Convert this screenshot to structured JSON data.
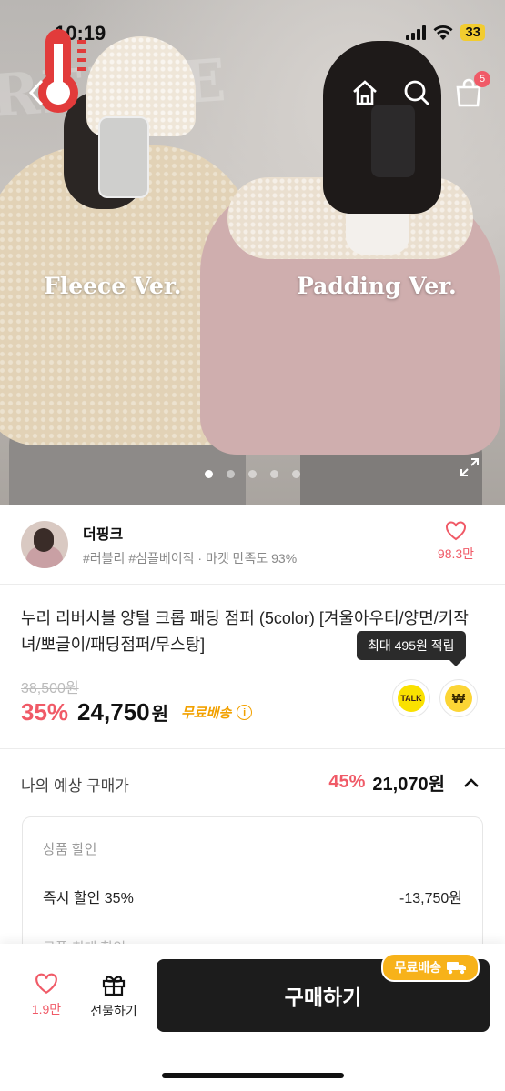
{
  "status": {
    "time": "10:19",
    "battery": "33"
  },
  "hero": {
    "bg_text": "RERSE",
    "label_left": "Fleece Ver.",
    "label_right": "Padding Ver.",
    "cart_count": "5",
    "slide_count": 5,
    "active_slide": 1
  },
  "shop": {
    "name": "더핑크",
    "tags": "#러블리 #심플베이직 · 마켓 만족도 93%",
    "likes": "98.3만"
  },
  "product": {
    "title": "누리 리버시블 양털 크롭 패딩 점퍼 (5color) [겨울아우터/양면/키작녀/뽀글이/패딩점퍼/무스탕]",
    "tooltip": "최대 495원 적립",
    "original_price": "38,500원",
    "discount": "35%",
    "price": "24,750",
    "price_unit": "원",
    "free_shipping": "무료배송",
    "talk_label": "TALK",
    "won_symbol": "₩"
  },
  "estimate": {
    "label": "나의 예상 구매가",
    "discount": "45%",
    "price": "21,070원"
  },
  "breakdown": {
    "title": "상품 할인",
    "row_label": "즉시 할인 35%",
    "row_value": "-13,750원",
    "next_label": "쿠폰 최대 할인"
  },
  "bottom_bar": {
    "like_count": "1.9만",
    "gift_label": "선물하기",
    "buy_label": "구매하기",
    "buy_badge": "무료배송"
  },
  "colors": {
    "accent": "#f05a67",
    "shipping": "#f2a100",
    "buy": "#1c1c1c"
  }
}
